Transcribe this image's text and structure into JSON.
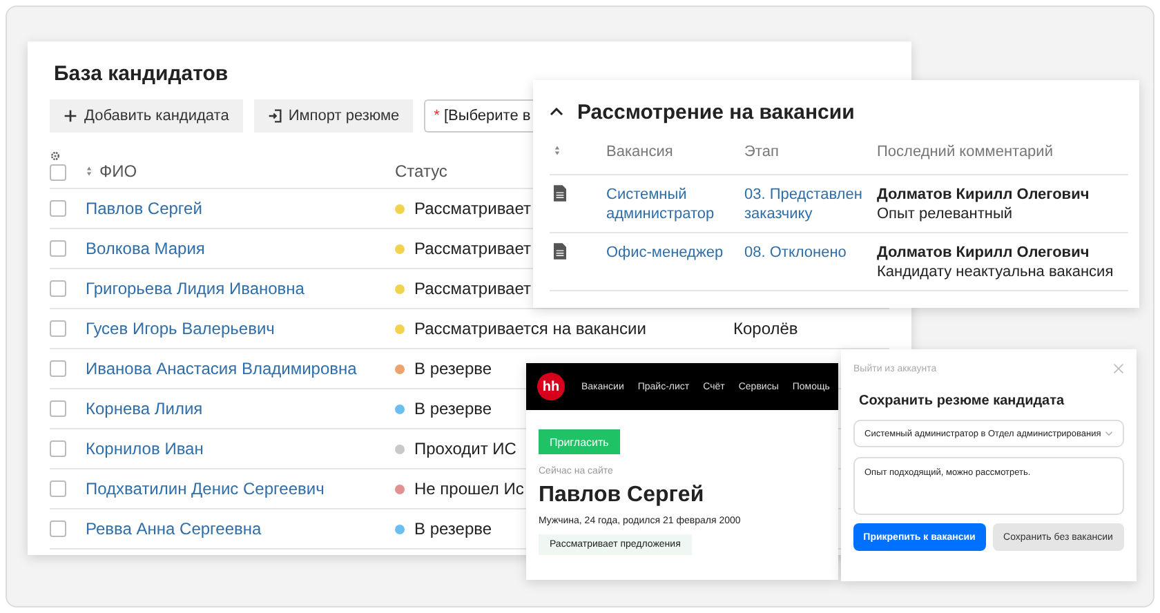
{
  "candidates": {
    "title": "База кандидатов",
    "toolbar": [
      {
        "kind": "add",
        "label": "Добавить кандидата"
      },
      {
        "kind": "import",
        "label": "Импорт резюме"
      }
    ],
    "vacancy_select": {
      "required_mark": "*",
      "value": "[Выберите в"
    },
    "select_all_checked": false,
    "columns": [
      "ФИО",
      "Статус"
    ],
    "rows": [
      {
        "checked": false,
        "name": "Павлов Сергей",
        "status": "Рассматривает",
        "color": "#f2d34f"
      },
      {
        "checked": false,
        "name": "Волкова Мария",
        "status": "Рассматривает",
        "color": "#f2d34f"
      },
      {
        "checked": false,
        "name": "Григорьева Лидия Ивановна",
        "status": "Рассматривает",
        "color": "#f2d34f"
      },
      {
        "checked": false,
        "name": "Гусев Игорь Валерьевич",
        "status": "Рассматривается на вакансии",
        "color": "#f2d34f",
        "column_3": "Королёв"
      },
      {
        "checked": false,
        "name": "Иванова Анастасия Владимировна",
        "status": "В резерве",
        "color": "#eba46c"
      },
      {
        "checked": false,
        "name": "Корнева Лилия",
        "status": "В резерве",
        "color": "#6cbdf0"
      },
      {
        "checked": false,
        "name": "Корнилов Иван",
        "status": "Проходит ИС",
        "color": "#c9c9c9"
      },
      {
        "checked": false,
        "name": "Подхватилин Денис Сергеевич",
        "status": "Не прошел Ис",
        "color": "#e39090"
      },
      {
        "checked": false,
        "name": "Ревва Анна Сергеевна",
        "status": "В резерве",
        "color": "#6cbdf0"
      }
    ]
  },
  "vacancies": {
    "title": "Рассмотрение на вакансии",
    "expanded": true,
    "columns": [
      "Вакансия",
      "Этап",
      "Последний комментарий"
    ],
    "rows": [
      {
        "vacancy": "Системный администратор",
        "stage": "03. Представлен заказчику",
        "author": "Долматов Кирилл Олегович",
        "comment": "Опыт релевантный"
      },
      {
        "vacancy": "Офис-менеджер",
        "stage": "08. Отклонено",
        "author": "Долматов Кирилл Олегович",
        "comment": "Кандидату неактуальна вакансия"
      }
    ]
  },
  "hh_page": {
    "logo": "hh",
    "nav": [
      "Вакансии",
      "Прайс-лист",
      "Счёт",
      "Сервисы",
      "Помощь"
    ],
    "invite_button": "Пригласить",
    "online": "Сейчас на сайте",
    "name": "Павлов Сергей",
    "details": "Мужчина, 24 года, родился 21 февраля 2000",
    "badge": "Рассматривает предложения"
  },
  "save_dialog": {
    "logout": "Выйти из аккаунта",
    "title": "Сохранить резюме кандидата",
    "vacancy": "Системный администратор в Отдел администрирования",
    "comment": "Опыт подходящий, можно рассмотреть.",
    "buttons": [
      {
        "kind": "primary",
        "label": "Прикрепить к вакансии"
      },
      {
        "kind": "secondary",
        "label": "Сохранить без вакансии"
      }
    ]
  }
}
